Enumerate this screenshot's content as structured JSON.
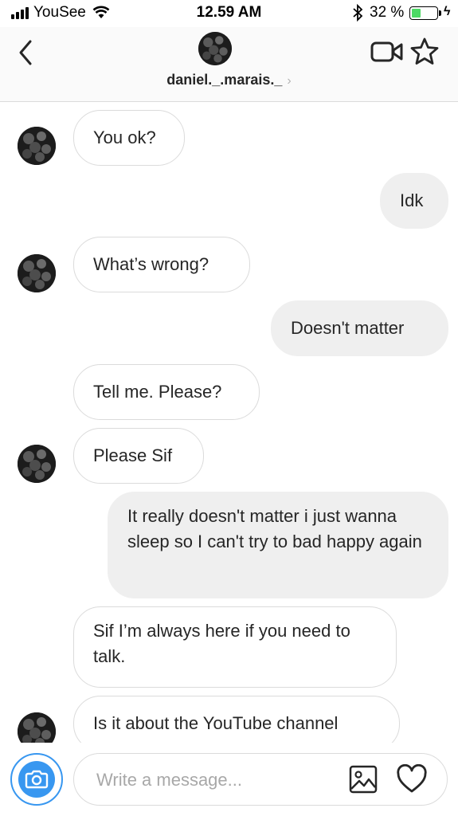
{
  "status_bar": {
    "carrier": "YouSee",
    "time": "12.59 AM",
    "battery_percent_text": "32 %",
    "battery_level": 0.32
  },
  "header": {
    "username": "daniel._.marais._",
    "chevron": "›",
    "icons": [
      "back-chevron-icon",
      "video-call-icon",
      "star-icon"
    ]
  },
  "messages": [
    {
      "from": "them",
      "text": "You ok?",
      "avatar": true
    },
    {
      "from": "me",
      "text": "Idk"
    },
    {
      "from": "them",
      "text": "What’s wrong?",
      "avatar": true
    },
    {
      "from": "me",
      "text": "Doesn't matter"
    },
    {
      "from": "them",
      "text": "Tell me. Please?",
      "avatar": false
    },
    {
      "from": "them",
      "text": "Please Sif",
      "avatar": true
    },
    {
      "from": "me",
      "text": "It really doesn't matter i just wanna sleep so I can't try to bad happy again"
    },
    {
      "from": "them",
      "text": "Sif I’m always here if you need to talk.",
      "avatar": false
    },
    {
      "from": "them",
      "text": "Is it about the YouTube channel",
      "avatar": true
    }
  ],
  "composer": {
    "placeholder": "Write a message...",
    "icons": [
      "camera-icon",
      "gallery-icon",
      "heart-icon"
    ]
  },
  "colors": {
    "accent": "#3897f0",
    "battery_green": "#4cd964",
    "outgoing_bubble": "#efefef",
    "incoming_border": "#dbdbdb"
  }
}
